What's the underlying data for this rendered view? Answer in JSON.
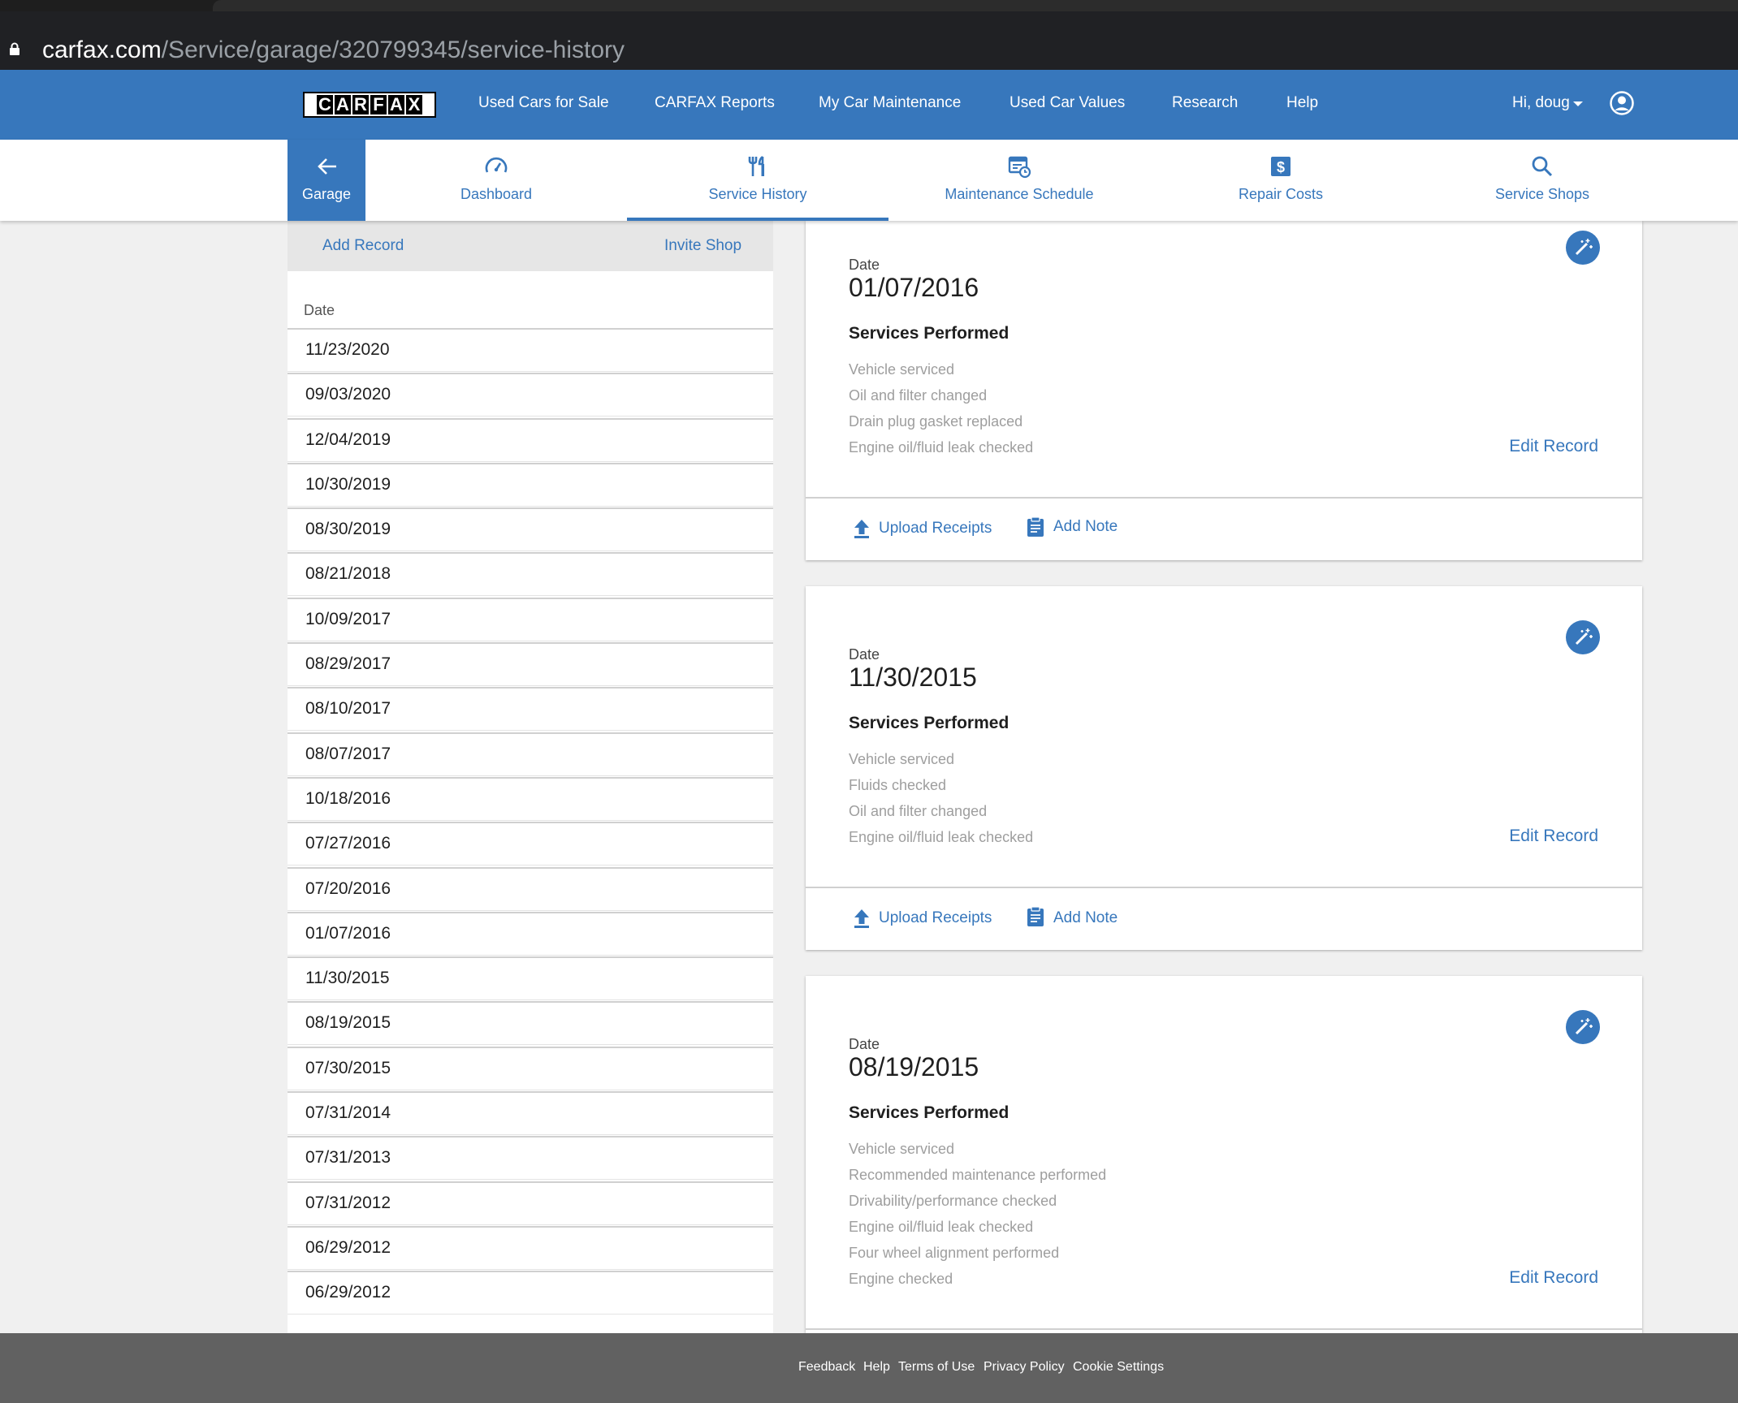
{
  "browser": {
    "url_host": "carfax.com",
    "url_path": "/Service/garage/320799345/service-history"
  },
  "topnav": {
    "logo_text": "CARFAX",
    "links": [
      "Used Cars for Sale",
      "CARFAX Reports",
      "My Car Maintenance",
      "Used Car Values",
      "Research",
      "Help"
    ],
    "user_greeting": "Hi, doug"
  },
  "subnav": {
    "back_label": "Garage",
    "tabs": [
      "Dashboard",
      "Service History",
      "Maintenance Schedule",
      "Repair Costs",
      "Service Shops"
    ],
    "active_tab": "Service History"
  },
  "sidebar": {
    "add_record": "Add Record",
    "invite_shop": "Invite Shop",
    "date_header": "Date",
    "dates": [
      "11/23/2020",
      "09/03/2020",
      "12/04/2019",
      "10/30/2019",
      "08/30/2019",
      "08/21/2018",
      "10/09/2017",
      "08/29/2017",
      "08/10/2017",
      "08/07/2017",
      "10/18/2016",
      "07/27/2016",
      "07/20/2016",
      "01/07/2016",
      "11/30/2015",
      "08/19/2015",
      "07/30/2015",
      "07/31/2014",
      "07/31/2013",
      "07/31/2012",
      "06/29/2012",
      "06/29/2012"
    ]
  },
  "records": [
    {
      "date_label": "Date",
      "date": "01/07/2016",
      "services_header": "Services Performed",
      "services": [
        "Vehicle serviced",
        "Oil and filter changed",
        "Drain plug gasket replaced",
        "Engine oil/fluid leak checked"
      ],
      "edit_label": "Edit Record",
      "upload_label": "Upload Receipts",
      "note_label": "Add Note"
    },
    {
      "date_label": "Date",
      "date": "11/30/2015",
      "services_header": "Services Performed",
      "services": [
        "Vehicle serviced",
        "Fluids checked",
        "Oil and filter changed",
        "Engine oil/fluid leak checked"
      ],
      "edit_label": "Edit Record",
      "upload_label": "Upload Receipts",
      "note_label": "Add Note"
    },
    {
      "date_label": "Date",
      "date": "08/19/2015",
      "services_header": "Services Performed",
      "services": [
        "Vehicle serviced",
        "Recommended maintenance performed",
        "Drivability/performance checked",
        "Engine oil/fluid leak checked",
        "Four wheel alignment performed",
        "Engine checked"
      ],
      "edit_label": "Edit Record"
    }
  ],
  "footer": {
    "links": [
      "Feedback",
      "Help",
      "Terms of Use",
      "Privacy Policy",
      "Cookie Settings"
    ]
  },
  "colors": {
    "brand_blue": "#3777bc",
    "footer_gray": "#616161",
    "service_text_gray": "#9e9e9e"
  }
}
